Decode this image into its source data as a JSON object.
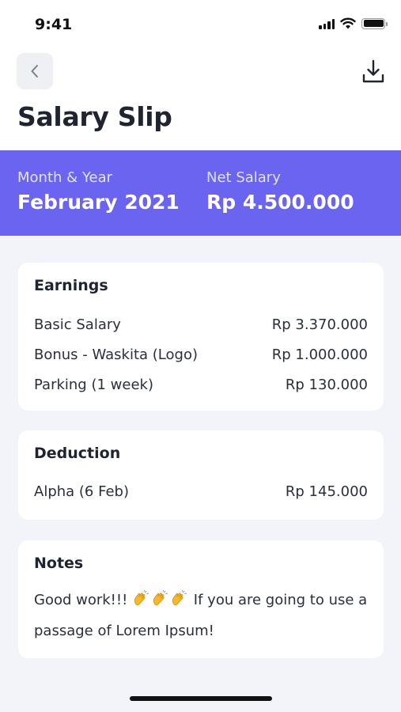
{
  "status_bar": {
    "time": "9:41"
  },
  "header": {
    "title": "Salary Slip",
    "back_icon": "chevron-left-icon",
    "download_icon": "download-icon"
  },
  "summary": {
    "month_label": "Month & Year",
    "month_value": "February 2021",
    "net_label": "Net Salary",
    "net_value": "Rp 4.500.000"
  },
  "earnings": {
    "title": "Earnings",
    "items": [
      {
        "label": "Basic Salary",
        "amount": "Rp 3.370.000"
      },
      {
        "label": "Bonus - Waskita (Logo)",
        "amount": "Rp 1.000.000"
      },
      {
        "label": "Parking (1 week)",
        "amount": "Rp 130.000"
      }
    ]
  },
  "deduction": {
    "title": "Deduction",
    "items": [
      {
        "label": "Alpha (6 Feb)",
        "amount": "Rp 145.000"
      }
    ]
  },
  "notes": {
    "title": "Notes",
    "text_before": "Good work!!!",
    "emoji": "clapping-hands-icon",
    "text_after": "If you are going to use a passage of Lorem Ipsum!"
  },
  "colors": {
    "accent": "#6a64f1",
    "background": "#f3f4f9",
    "card": "#ffffff",
    "text": "#1f2430"
  }
}
